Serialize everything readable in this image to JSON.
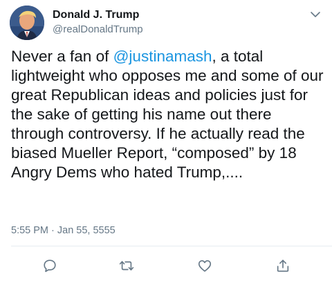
{
  "tweet": {
    "author": {
      "display_name": "Donald J. Trump",
      "handle": "@realDonaldTrump"
    },
    "text": {
      "before_mention": "Never a fan of ",
      "mention": "@justinamash",
      "after_mention": ", a total lightweight who opposes me and some of our great Republican ideas and policies just for the sake of getting his name out there through controversy. If he actually read the biased Mueller Report, “composed” by 18 Angry Dems who hated Trump,...."
    },
    "timestamp": "5:55 PM · Jan 55, 5555"
  },
  "icons": {
    "menu": "chevron-down-icon",
    "reply": "reply-icon",
    "retweet": "retweet-icon",
    "like": "heart-icon",
    "share": "share-icon"
  },
  "colors": {
    "link": "#1b95e0",
    "secondary_text": "#657786",
    "primary_text": "#14171a",
    "divider": "#e6ecf0"
  }
}
